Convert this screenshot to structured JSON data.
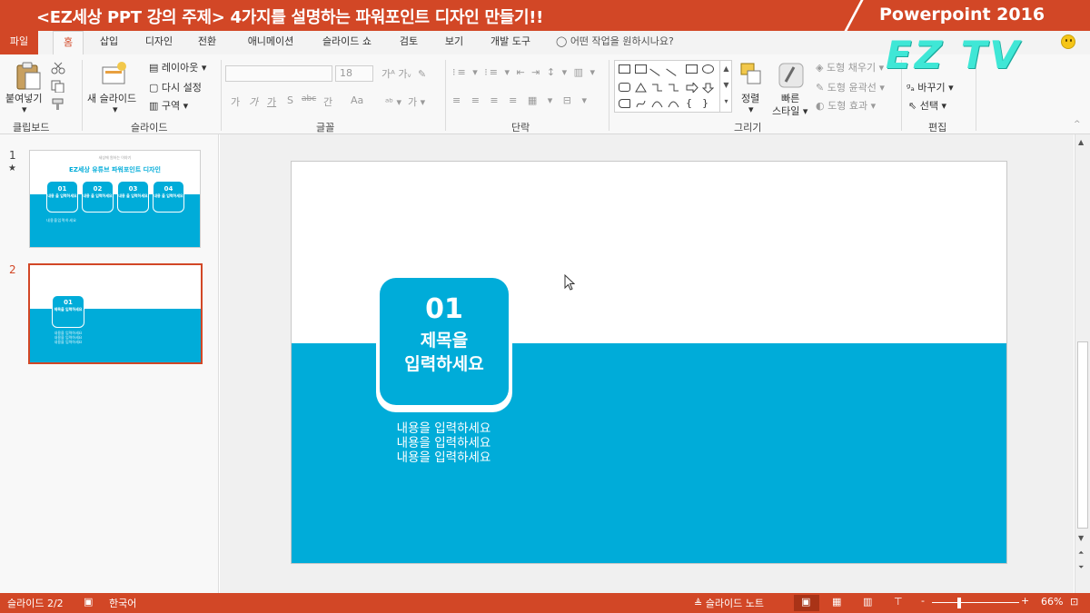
{
  "banner": {
    "title": "<EZ세상 PPT 강의 주제> 4가지를 설명하는 파워포인트 디자인 만들기!!",
    "right_text": "Powerpoint 2016",
    "color": "#d24726"
  },
  "watermark": "EZ TV",
  "tabs": {
    "file": "파일",
    "home": "홈",
    "insert": "삽입",
    "design": "디자인",
    "transitions": "전환",
    "animations": "애니메이션",
    "slideshow": "슬라이드 쇼",
    "review": "검토",
    "view": "보기",
    "developer": "개발 도구",
    "tell_me": "어떤 작업을 원하시나요?"
  },
  "ribbon": {
    "clipboard": {
      "paste": "붙여넣기",
      "label": "클립보드"
    },
    "slides": {
      "new_slide": "새 슬라이드",
      "layout": "레이아웃",
      "reset": "다시 설정",
      "section": "구역",
      "label": "슬라이드"
    },
    "font": {
      "font_name": "",
      "font_size": "18",
      "label": "글꼴",
      "bold": "가",
      "italic": "가",
      "underline": "가",
      "shadow": "S",
      "strike": "abc",
      "spacing": "간",
      "case": "Aa"
    },
    "paragraph": {
      "label": "단락"
    },
    "drawing": {
      "arrange": "정렬",
      "quick_styles": "빠른",
      "quick_styles2": "스타일",
      "fill": "도형 채우기",
      "outline": "도형 윤곽선",
      "effects": "도형 효과",
      "label": "그리기"
    },
    "editing": {
      "replace": "바꾸기",
      "select": "선택",
      "label": "편집"
    }
  },
  "thumbnails": [
    {
      "number": "1",
      "star": "★",
      "title": "EZ세상 유튜브 파워포인트 디자인",
      "subtitle": "세상에 원하는 이야기",
      "items": [
        {
          "num": "01",
          "text": "내용 을 입력하세요"
        },
        {
          "num": "02",
          "text": "내용 을 입력하세요"
        },
        {
          "num": "03",
          "text": "내용 을 입력하세요"
        },
        {
          "num": "04",
          "text": "내용 을 입력하세요"
        }
      ],
      "body": "내용을입력하세요"
    },
    {
      "number": "2",
      "card_num": "01",
      "card_text": "제목을 입력하세요",
      "body": "내용을 입력하세요"
    }
  ],
  "slide": {
    "card_number": "01",
    "card_title_1": "제목을",
    "card_title_2": "입력하세요",
    "body_lines": [
      "내용을 입력하세요",
      "내용을 입력하세요",
      "내용을 입력하세요"
    ],
    "accent": "#00acd9"
  },
  "status": {
    "slide_counter": "슬라이드 2/2",
    "language": "한국어",
    "notes": "슬라이드 노트",
    "zoom": "66%",
    "zoom_minus": "-",
    "zoom_plus": "+"
  }
}
